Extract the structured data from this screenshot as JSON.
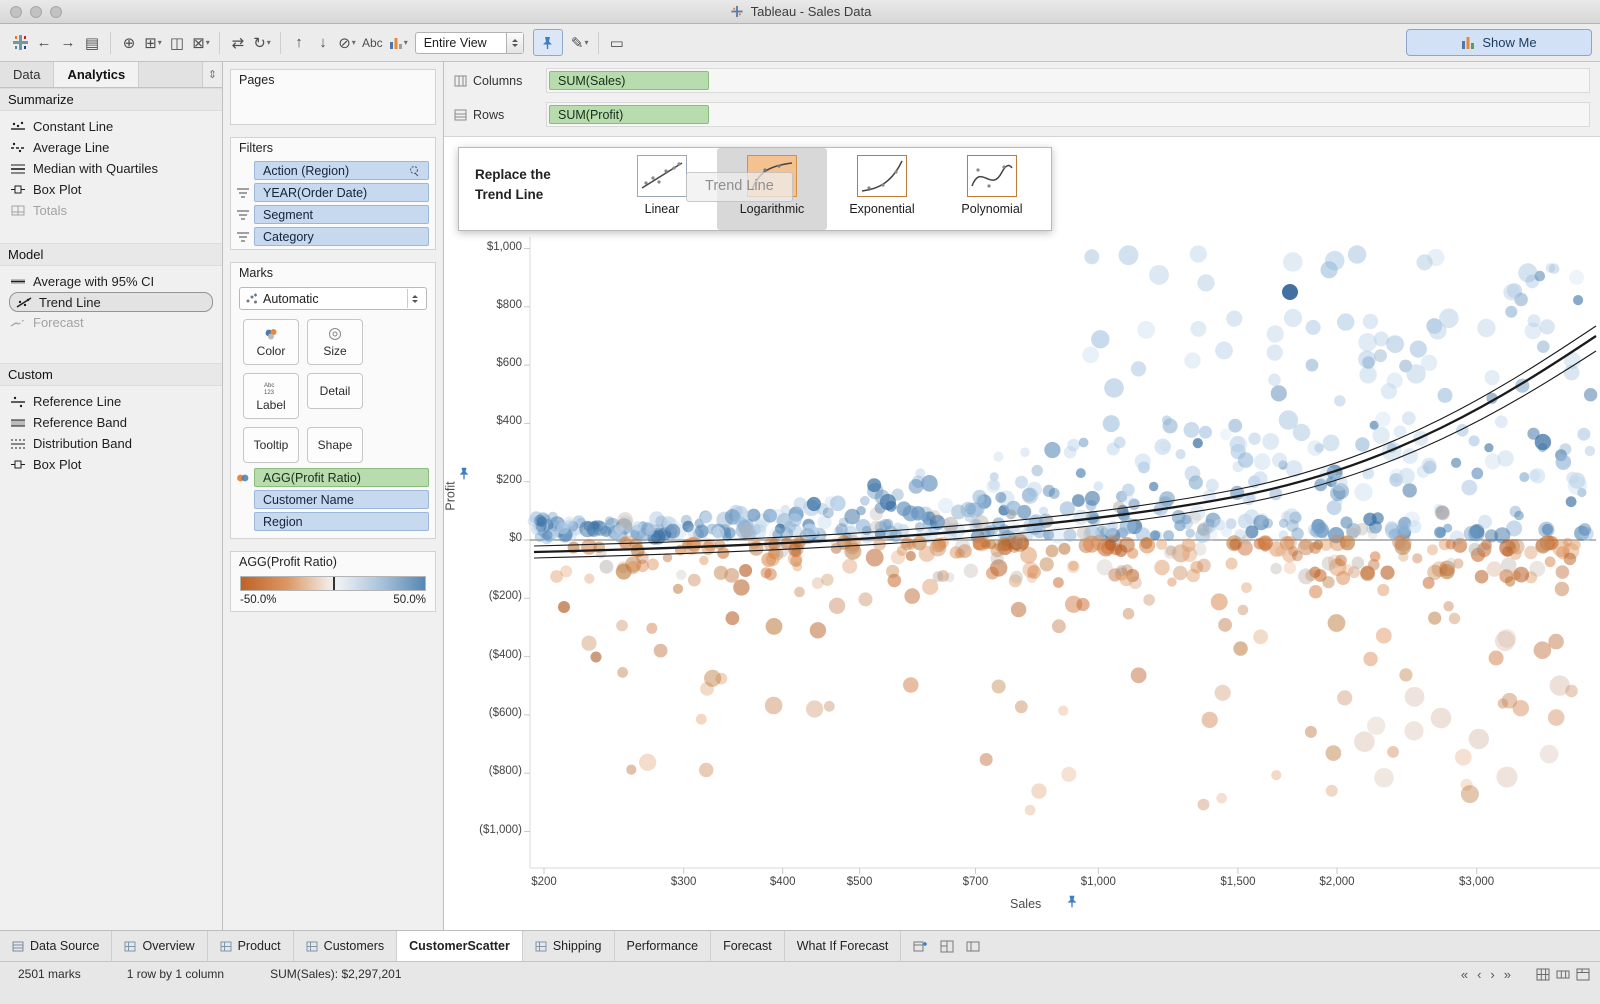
{
  "window": {
    "title": "Tableau - Sales Data"
  },
  "toolbar": {
    "icons": {
      "undo": "←",
      "redo": "→",
      "save": "▤",
      "add_data": "⊕",
      "new_sheet": "⊞",
      "duplicate": "◫",
      "clear": "⊠",
      "swap": "⇄",
      "refresh": "↻",
      "sort_asc": "↑",
      "sort_desc": "↓",
      "group": "⊘",
      "caret": "▾",
      "abc": "Abc",
      "highlight": "✎",
      "present": "▭"
    },
    "fit_value": "Entire View",
    "show_me": "Show Me"
  },
  "left_panel": {
    "tabs": {
      "data": "Data",
      "analytics": "Analytics"
    },
    "splitter_glyph": "⇕",
    "sections": [
      {
        "title": "Summarize",
        "items": [
          {
            "label": "Constant Line"
          },
          {
            "label": "Average Line"
          },
          {
            "label": "Median with Quartiles"
          },
          {
            "label": "Box Plot"
          },
          {
            "label": "Totals",
            "disabled": true
          }
        ]
      },
      {
        "title": "Model",
        "items": [
          {
            "label": "Average with 95% CI"
          },
          {
            "label": "Trend Line",
            "selected": true
          },
          {
            "label": "Forecast",
            "disabled": true
          }
        ]
      },
      {
        "title": "Custom",
        "items": [
          {
            "label": "Reference Line"
          },
          {
            "label": "Reference Band"
          },
          {
            "label": "Distribution Band"
          },
          {
            "label": "Box Plot"
          }
        ]
      }
    ]
  },
  "cards": {
    "pages_title": "Pages",
    "filters_title": "Filters",
    "filters": [
      "Action (Region)",
      "YEAR(Order Date)",
      "Segment",
      "Category"
    ],
    "marks_title": "Marks",
    "mark_type": "Automatic",
    "mark_buttons": [
      "Color",
      "Size",
      "Label",
      "Detail",
      "Tooltip",
      "Shape"
    ],
    "mark_pills": [
      "AGG(Profit Ratio)",
      "Customer Name",
      "Region"
    ],
    "legend": {
      "title": "AGG(Profit Ratio)",
      "min": "-50.0%",
      "max": "50.0%"
    }
  },
  "shelves": {
    "columns_label": "Columns",
    "rows_label": "Rows",
    "columns_pill": "SUM(Sales)",
    "rows_pill": "SUM(Profit)"
  },
  "overlay": {
    "title_1": "Replace the",
    "title_2": "Trend Line",
    "options": [
      "Linear",
      "Logarithmic",
      "Exponential",
      "Polynomial"
    ],
    "selected": "Logarithmic",
    "ghost_label": "Trend Line"
  },
  "chart_data": {
    "type": "scatter",
    "xlabel": "Sales",
    "ylabel": "Profit",
    "x_scale": "log",
    "x_range": [
      150,
      3800
    ],
    "y_range": [
      -1050,
      1050
    ],
    "x_ticks": [
      {
        "v": 200,
        "label": "$200"
      },
      {
        "v": 300,
        "label": "$300"
      },
      {
        "v": 400,
        "label": "$400"
      },
      {
        "v": 500,
        "label": "$500"
      },
      {
        "v": 700,
        "label": "$700"
      },
      {
        "v": 1000,
        "label": "$1,000"
      },
      {
        "v": 1500,
        "label": "$1,500"
      },
      {
        "v": 2000,
        "label": "$2,000"
      },
      {
        "v": 3000,
        "label": "$3,000"
      }
    ],
    "y_ticks": [
      {
        "v": 1000,
        "label": "$1,000"
      },
      {
        "v": 800,
        "label": "$800"
      },
      {
        "v": 600,
        "label": "$600"
      },
      {
        "v": 400,
        "label": "$400"
      },
      {
        "v": 200,
        "label": "$200"
      },
      {
        "v": 0,
        "label": "$0"
      },
      {
        "v": -200,
        "label": "($200)"
      },
      {
        "v": -400,
        "label": "($400)"
      },
      {
        "v": -600,
        "label": "($600)"
      },
      {
        "v": -800,
        "label": "($800)"
      },
      {
        "v": -1000,
        "label": "($1,000)"
      }
    ],
    "marks_count": 2501,
    "color_encoding": {
      "field": "AGG(Profit Ratio)",
      "min_label": "-50.0%",
      "max_label": "50.0%",
      "negative_color": "#c8682c",
      "positive_color": "#4e79a7"
    },
    "trend": {
      "existing": "rising curve with confidence bands and zero line",
      "dragging": "Trend Line",
      "drop_target": "Logarithmic"
    },
    "summary": {
      "sum_sales": "$2,297,201"
    }
  },
  "sheet_tabs": {
    "tabs": [
      "Data Source",
      "Overview",
      "Product",
      "Customers",
      "CustomerScatter",
      "Shipping",
      "Performance",
      "Forecast",
      "What If Forecast"
    ],
    "active_index": 4
  },
  "status": {
    "marks": "2501 marks",
    "layout": "1 row by 1 column",
    "aggregate": "SUM(Sales): $2,297,201",
    "nav": [
      "«",
      "‹",
      "›",
      "»"
    ]
  }
}
